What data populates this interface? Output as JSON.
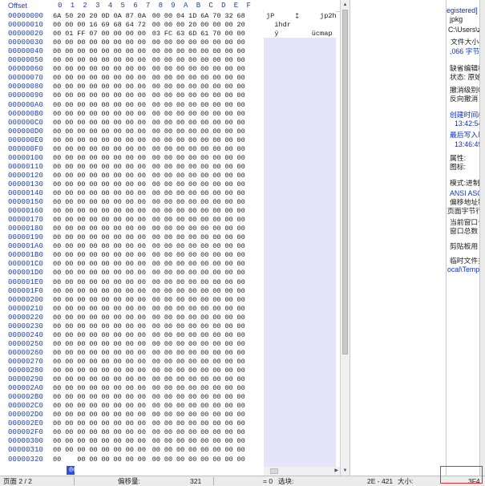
{
  "header": {
    "offset_label": "Offset",
    "columns": [
      "0",
      "1",
      "2",
      "3",
      "4",
      "5",
      "6",
      "7",
      "8",
      "9",
      "A",
      "B",
      "C",
      "D",
      "E",
      "F"
    ]
  },
  "offsets": [
    "00000000",
    "00000010",
    "00000020",
    "00000030",
    "00000040",
    "00000050",
    "00000060",
    "00000070",
    "00000080",
    "00000090",
    "000000A0",
    "000000B0",
    "000000C0",
    "000000D0",
    "000000E0",
    "000000F0",
    "00000100",
    "00000110",
    "00000120",
    "00000130",
    "00000140",
    "00000150",
    "00000160",
    "00000170",
    "00000180",
    "00000190",
    "000001A0",
    "000001B0",
    "000001C0",
    "000001D0",
    "000001E0",
    "000001F0",
    "00000200",
    "00000210",
    "00000220",
    "00000230",
    "00000240",
    "00000250",
    "00000260",
    "00000270",
    "00000280",
    "00000290",
    "000002A0",
    "000002B0",
    "000002C0",
    "000002D0",
    "000002E0",
    "000002F0",
    "00000300",
    "00000310",
    "00000320"
  ],
  "hex_rows": [
    [
      "6A",
      "50",
      "20",
      "20",
      "0D",
      "0A",
      "87",
      "0A",
      "00",
      "00",
      "04",
      "1D",
      "6A",
      "70",
      "32",
      "68"
    ],
    [
      "00",
      "00",
      "00",
      "16",
      "69",
      "68",
      "64",
      "72",
      "00",
      "00",
      "00",
      "20",
      "00",
      "00",
      "00",
      "20"
    ],
    [
      "00",
      "01",
      "FF",
      "07",
      "00",
      "00",
      "00",
      "00",
      "03",
      "FC",
      "63",
      "6D",
      "61",
      "70",
      "00",
      "00"
    ]
  ],
  "zero_byte": "00",
  "text_rows": [
    "jP     ‡     jp2h",
    "  ihdr",
    "  ÿ        ücmap"
  ],
  "last_row_caret_char": "00",
  "sidebar": [
    {
      "text": "egistered]",
      "color": "blue"
    },
    {
      "text": "jpkg",
      "color": "normal"
    },
    {
      "text": "C:\\Users\\z",
      "color": "normal"
    },
    {
      "text": "文件大小8",
      "color": "normal"
    },
    {
      "text": ",066 字节",
      "color": "blue"
    },
    {
      "text": "缺省编辑模",
      "color": "normal"
    },
    {
      "text": "状态: 原始",
      "color": "normal"
    },
    {
      "text": "撤消级别0",
      "color": "normal"
    },
    {
      "text": "反向撤消",
      "color": "normal"
    },
    {
      "text": "创建时间/25",
      "color": "blue"
    },
    {
      "text": "13:42:54",
      "color": "blue"
    },
    {
      "text": "最后写入时",
      "color": "blue"
    },
    {
      "text": "13:46:49",
      "color": "blue"
    },
    {
      "text": "属性:",
      "color": "normal"
    },
    {
      "text": "A",
      "color": "blue"
    },
    {
      "text": "图标:",
      "color": "normal"
    },
    {
      "text": "0",
      "color": "blue"
    },
    {
      "text": "模式:进制",
      "color": "normal"
    },
    {
      "text": "ANSI ASCII",
      "color": "blue"
    },
    {
      "text": "偏移地址制",
      "color": "normal"
    },
    {
      "text": "页面字节行",
      "color": "normal"
    },
    {
      "text": "当前窗口号",
      "color": "normal"
    },
    {
      "text": "窗口总数",
      "color": "normal"
    },
    {
      "text": "剪贴板用",
      "color": "normal"
    },
    {
      "text": "临时文件夹",
      "color": "normal"
    },
    {
      "text": "ocal\\Temp",
      "color": "blue"
    }
  ],
  "status": {
    "page": "页面 2 / 2",
    "offset_label": "偏移量:",
    "offset_value": "321",
    "eq": "= 0",
    "select_label": "选块:",
    "range": "2E - 421",
    "size_label": "大小:",
    "size_value": "3F4"
  },
  "colors": {
    "offset_blue": "#2040b0",
    "text_bg": "#e4e4fb",
    "caret": "#3050e0",
    "highlight_box": "#e03030"
  }
}
